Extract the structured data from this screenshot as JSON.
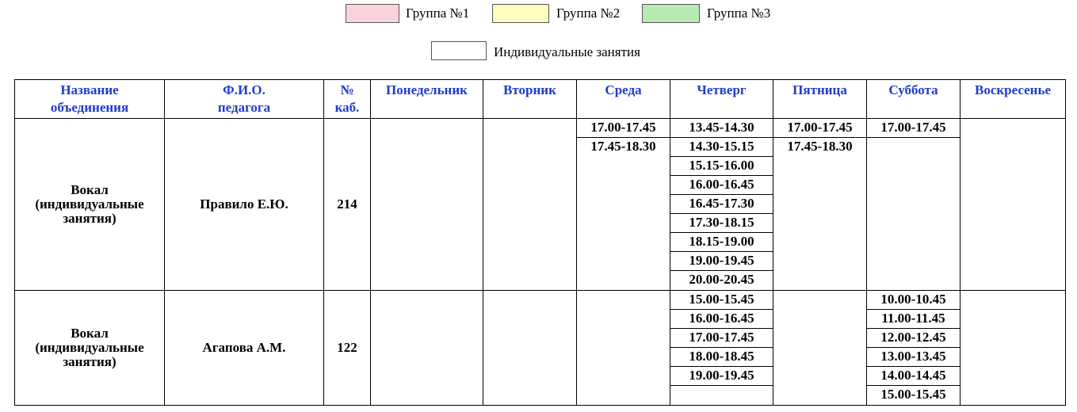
{
  "legend": {
    "group1_label": "Группа №1",
    "group2_label": "Группа №2",
    "group3_label": "Группа №3",
    "individual_label": "Индивидуальные занятия",
    "colors": {
      "group1": "#f9d3dc",
      "group2": "#fefcc0",
      "group3": "#b8eab6",
      "individual": "#ffffff"
    }
  },
  "table": {
    "headers": {
      "name_line1": "Название",
      "name_line2": "объединения",
      "teacher_line1": "Ф.И.О.",
      "teacher_line2": "педагога",
      "room_line1": "№",
      "room_line2": "каб.",
      "mon": "Понедельник",
      "tue": "Вторник",
      "wed": "Среда",
      "thu": "Четверг",
      "fri": "Пятница",
      "sat": "Суббота",
      "sun": "Воскресенье"
    },
    "rows": [
      {
        "name_line1": "Вокал",
        "name_line2": "(индивидуальные",
        "name_line3": "занятия)",
        "teacher": "Правило Е.Ю.",
        "room": "214",
        "wed": [
          "17.00-17.45",
          "17.45-18.30"
        ],
        "thu": [
          "13.45-14.30",
          "14.30-15.15",
          "15.15-16.00",
          "16.00-16.45",
          "16.45-17.30",
          "17.30-18.15",
          "18.15-19.00",
          "19.00-19.45",
          "20.00-20.45"
        ],
        "fri": [
          "17.00-17.45",
          "17.45-18.30"
        ],
        "sat": [
          "17.00-17.45"
        ]
      },
      {
        "name_line1": "Вокал",
        "name_line2": "(индивидуальные",
        "name_line3": "занятия)",
        "teacher": "Агапова А.М.",
        "room": "122",
        "thu": [
          "15.00-15.45",
          "16.00-16.45",
          "17.00-17.45",
          "18.00-18.45",
          "19.00-19.45"
        ],
        "sat": [
          "10.00-10.45",
          "11.00-11.45",
          "12.00-12.45",
          "13.00-13.45",
          "14.00-14.45",
          "15.00-15.45"
        ]
      }
    ]
  }
}
